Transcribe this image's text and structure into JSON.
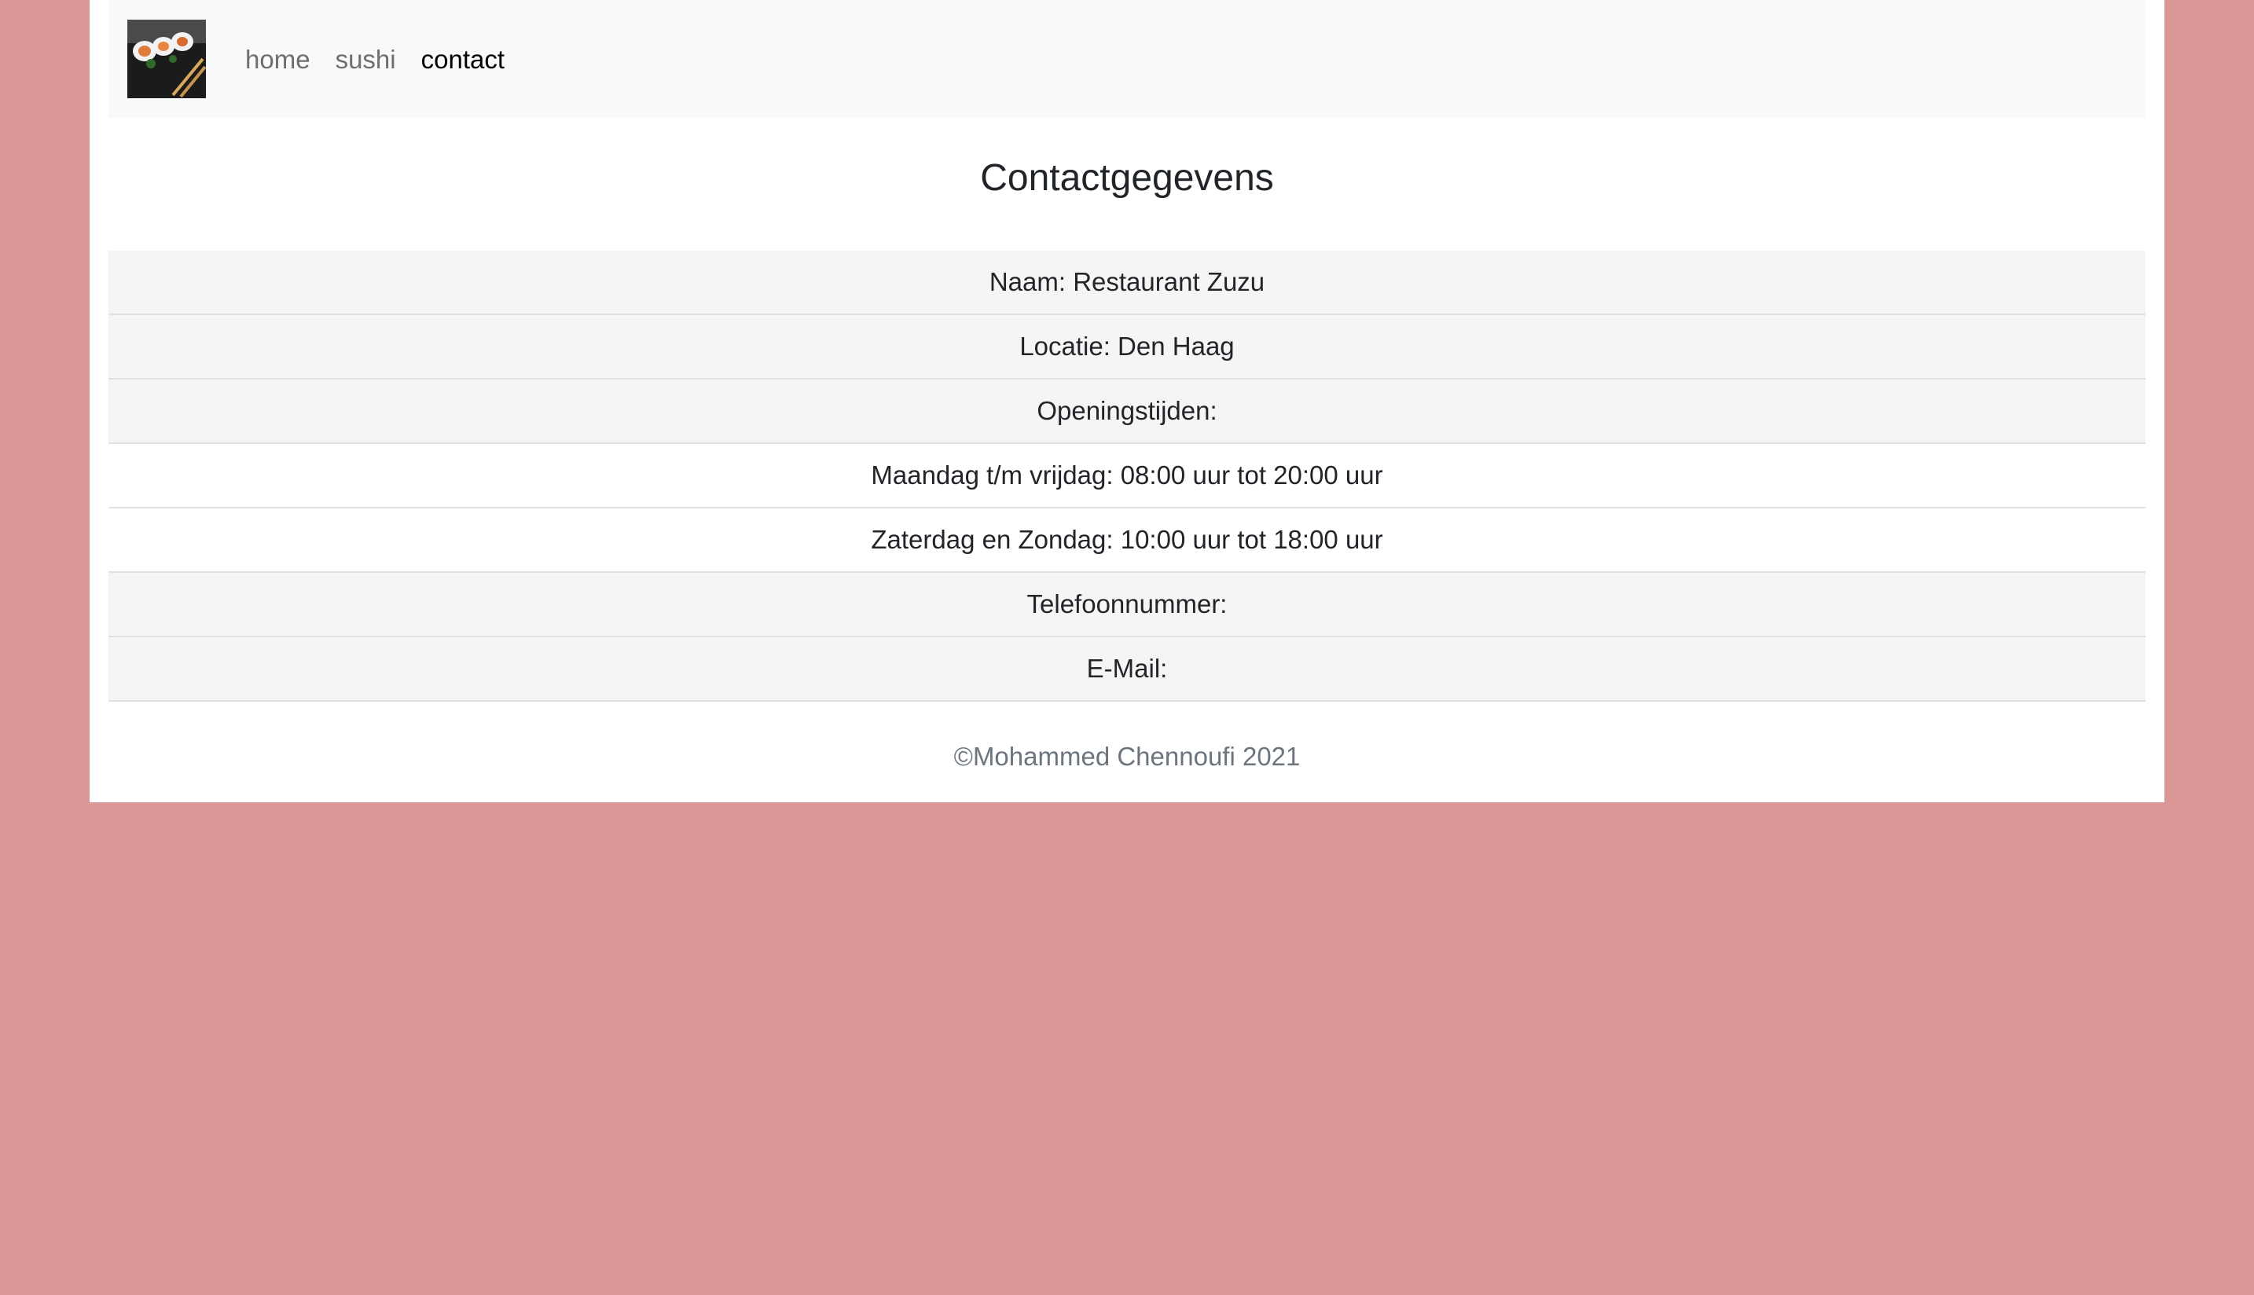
{
  "nav": {
    "logo_alt": "sushi logo",
    "links": [
      {
        "label": "home"
      },
      {
        "label": "sushi"
      },
      {
        "label": "contact"
      }
    ]
  },
  "main": {
    "title": "Contactgegevens",
    "rows": [
      {
        "text": "Naam: Restaurant Zuzu"
      },
      {
        "text": "Locatie: Den Haag"
      },
      {
        "text": "Openingstijden:"
      },
      {
        "text": "Maandag t/m vrijdag: 08:00 uur tot 20:00 uur"
      },
      {
        "text": "Zaterdag en Zondag: 10:00 uur tot 18:00 uur"
      },
      {
        "text": "Telefoonnummer:"
      },
      {
        "text": "E-Mail:"
      }
    ]
  },
  "footer": {
    "copyright": "©Mohammed Chennoufi 2021"
  },
  "colors": {
    "background": "#d99795",
    "navbar": "#f8f9fa",
    "striped_row": "#f5f5f5"
  }
}
